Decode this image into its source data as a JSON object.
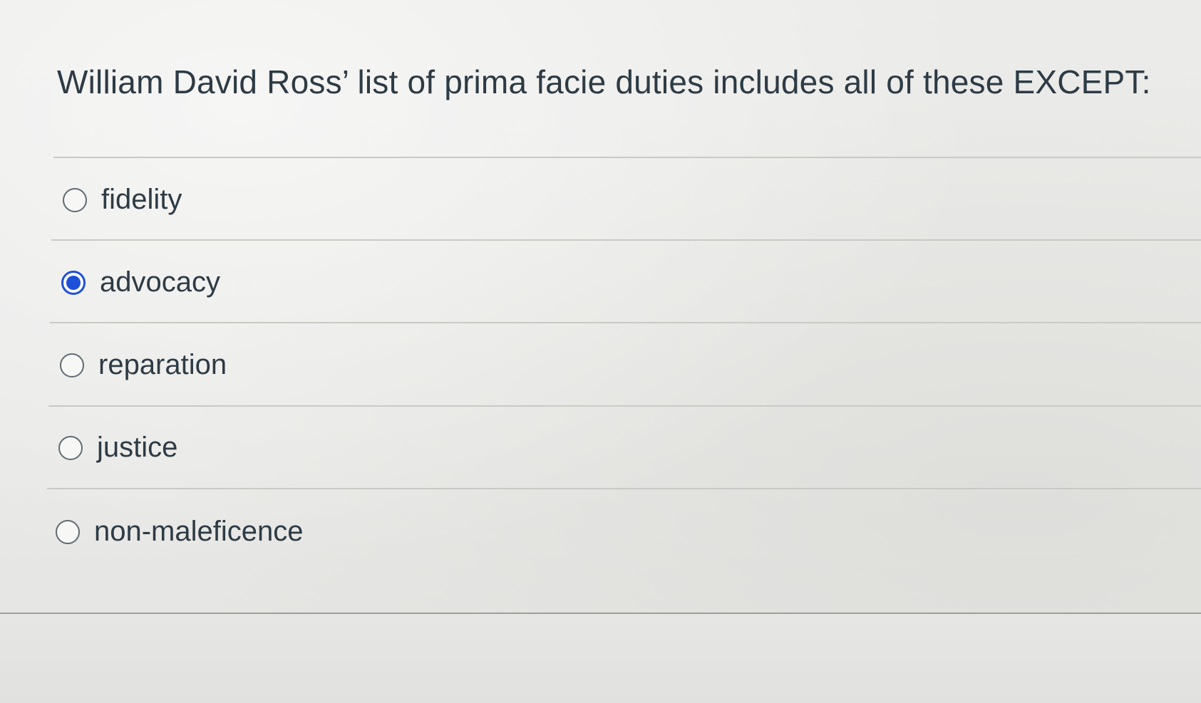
{
  "question": {
    "text": "William David Ross’ list of prima facie duties includes all of these EXCEPT:"
  },
  "answers": [
    {
      "label": "fidelity",
      "selected": false
    },
    {
      "label": "advocacy",
      "selected": true
    },
    {
      "label": "reparation",
      "selected": false
    },
    {
      "label": "justice",
      "selected": false
    },
    {
      "label": "non-maleficence",
      "selected": false
    }
  ],
  "colors": {
    "text": "#2d3b45",
    "selected_radio": "#1d4fd8",
    "divider": "#c9c9c6"
  }
}
